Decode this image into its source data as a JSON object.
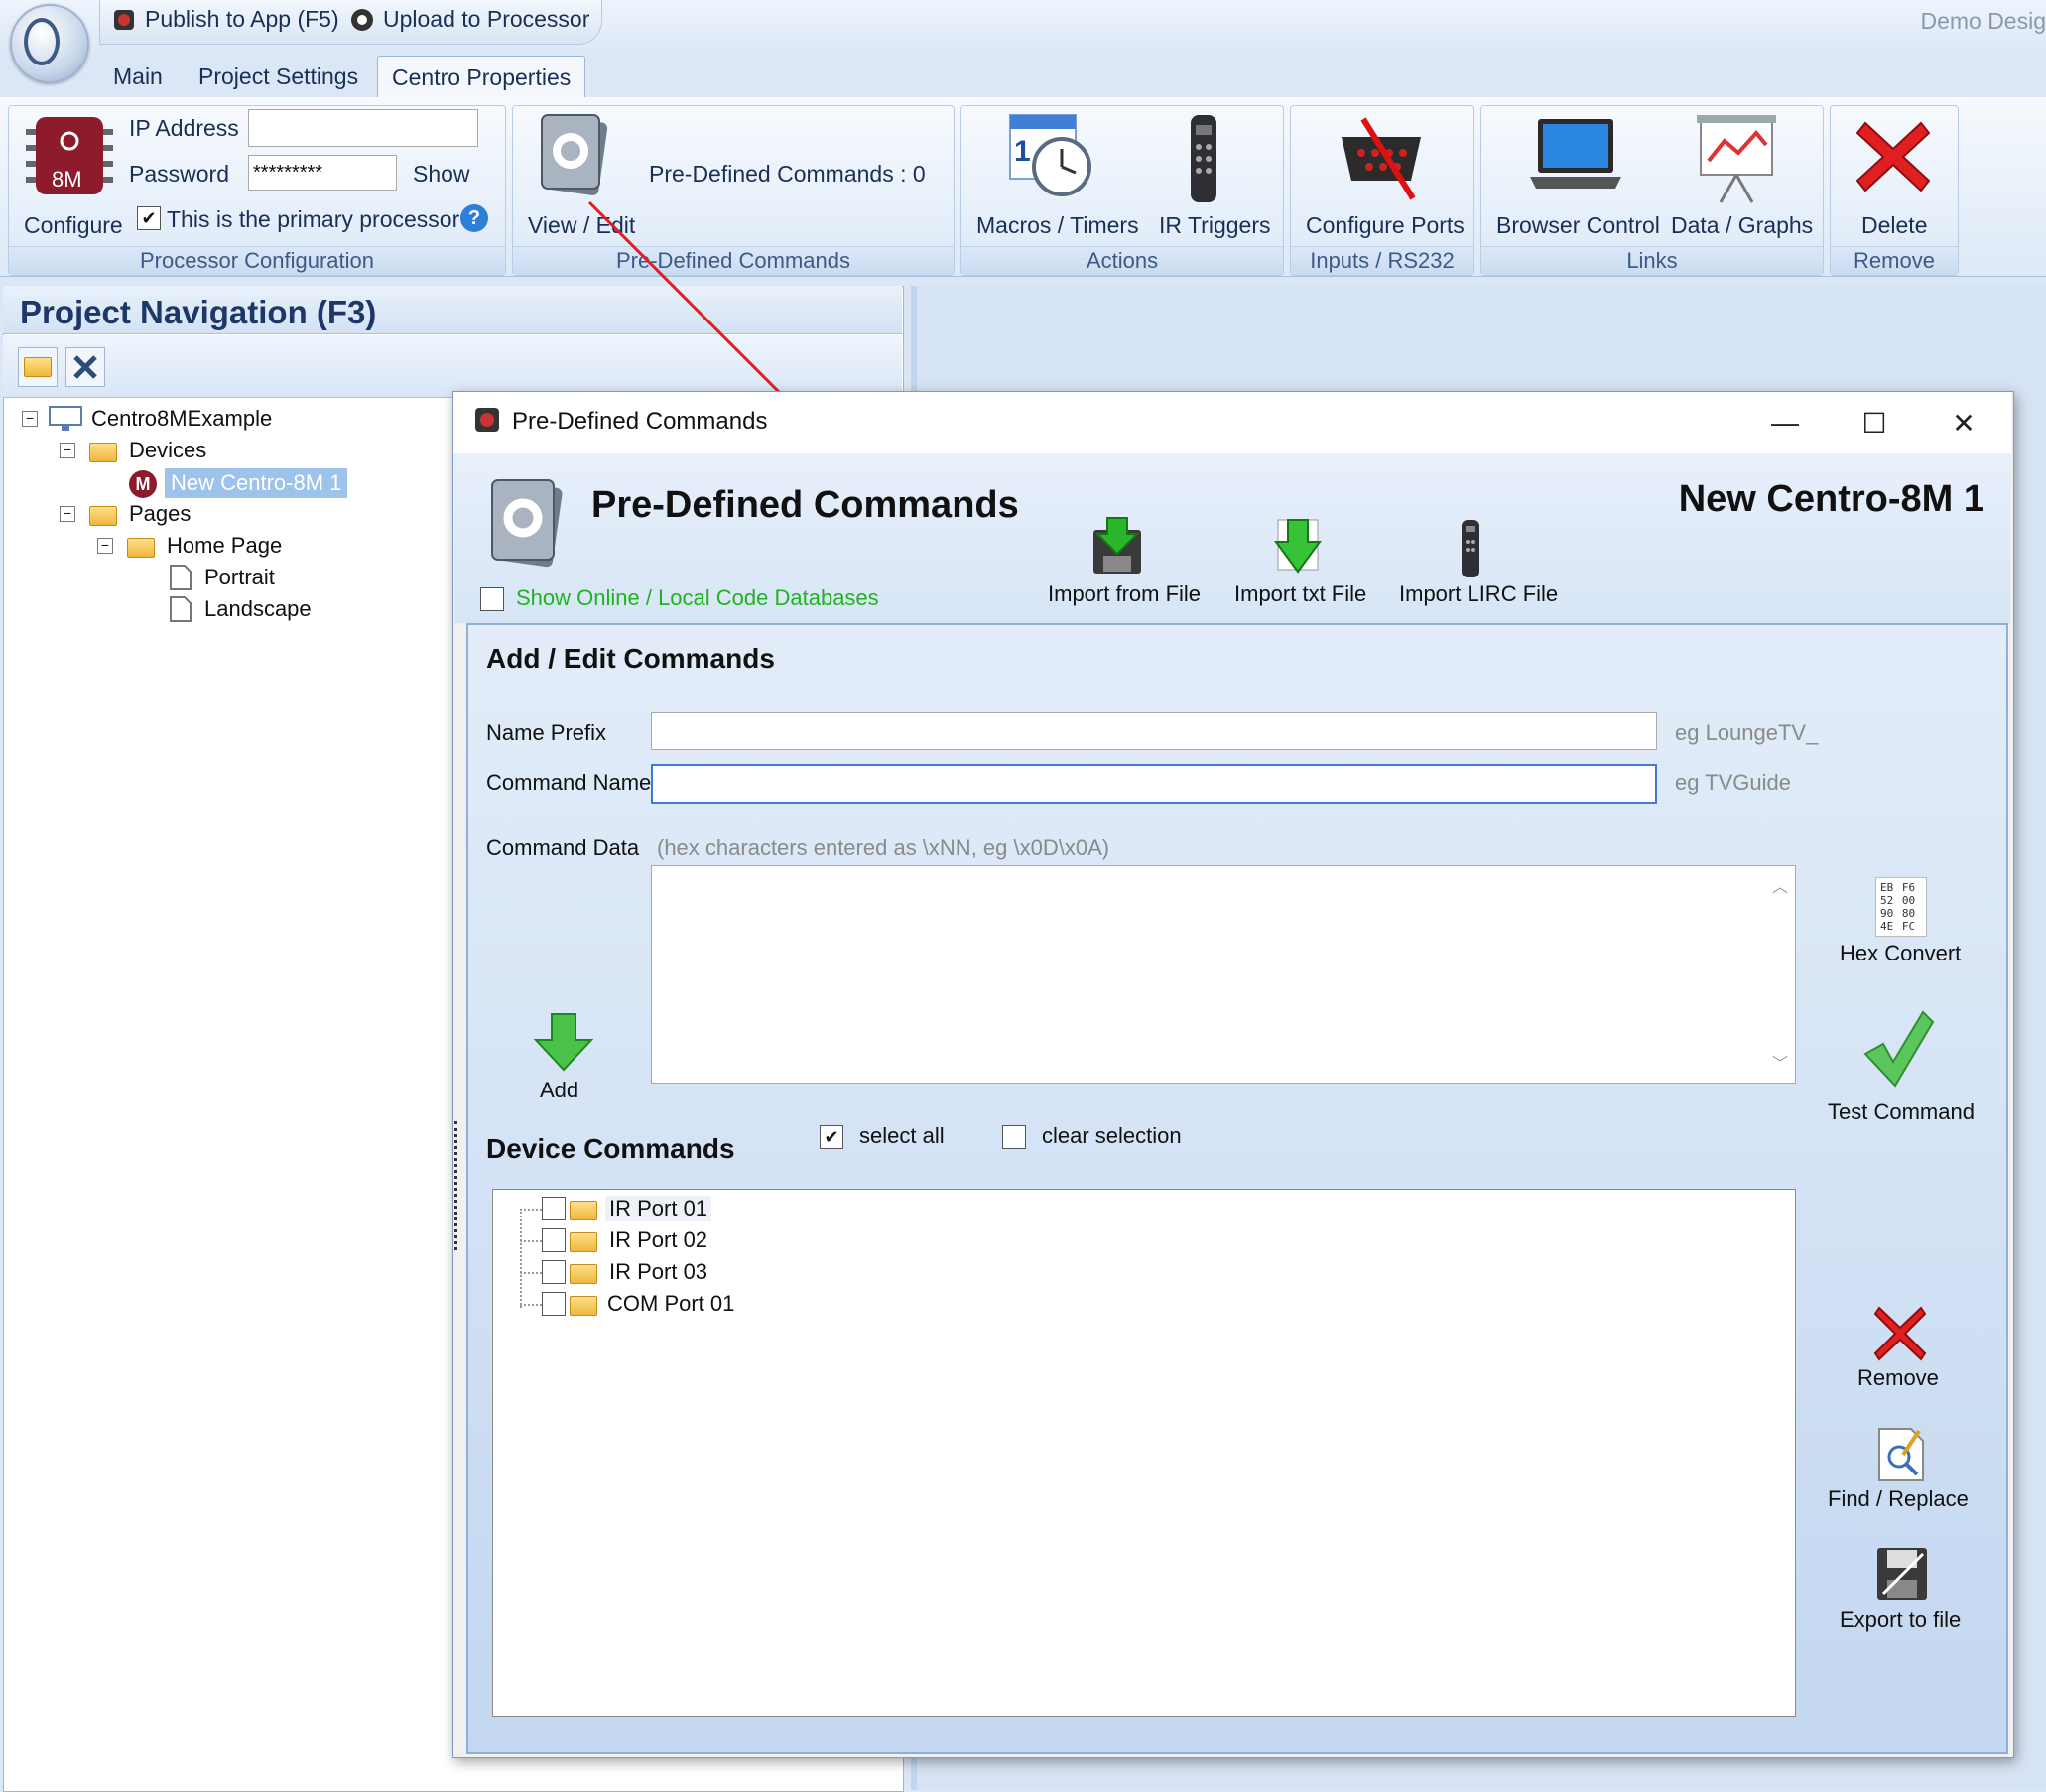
{
  "quickbar": {
    "publish_label": "Publish to App (F5)",
    "upload_label": "Upload to Processor",
    "app_title": "Demo Desig"
  },
  "tabs": [
    {
      "label": "Main"
    },
    {
      "label": "Project Settings"
    },
    {
      "label": "Centro Properties"
    }
  ],
  "ribbon": {
    "processor": {
      "configure_label": "Configure",
      "chip_text": "8M",
      "ip_label": "IP Address",
      "ip_value": "",
      "password_label": "Password",
      "password_value": "*********",
      "show_label": "Show",
      "primary_label": "This is the primary processor",
      "help_icon": "?",
      "caption": "Processor Configuration"
    },
    "predefined": {
      "view_edit_label": "View / Edit",
      "count_label": "Pre-Defined Commands : 0",
      "caption": "Pre-Defined Commands"
    },
    "actions": {
      "macros_label": "Macros / Timers",
      "ir_label": "IR Triggers",
      "calendar_number": "1",
      "caption": "Actions"
    },
    "inputs": {
      "configure_ports_label": "Configure Ports",
      "caption": "Inputs / RS232"
    },
    "links": {
      "browser_label": "Browser Control",
      "data_label": "Data / Graphs",
      "caption": "Links"
    },
    "remove": {
      "delete_label": "Delete",
      "caption": "Remove"
    }
  },
  "navigation": {
    "title": "Project Navigation (F3)",
    "tree": {
      "root": "Centro8MExample",
      "devices": "Devices",
      "device_item": "New Centro-8M 1",
      "device_badge": "M",
      "pages": "Pages",
      "home_page": "Home Page",
      "portrait": "Portrait",
      "landscape": "Landscape"
    }
  },
  "dialog": {
    "window_title": "Pre-Defined Commands",
    "heading": "Pre-Defined Commands",
    "device_name": "New Centro-8M 1",
    "show_online_label": "Show Online / Local Code Databases",
    "import_file_label": "Import from File",
    "import_txt_label": "Import txt File",
    "import_lirc_label": "Import LIRC File",
    "add_edit_title": "Add / Edit Commands",
    "name_prefix_label": "Name Prefix",
    "name_prefix_value": "",
    "name_prefix_hint": "eg LoungeTV_",
    "command_name_label": "Command Name",
    "command_name_value": "",
    "command_name_hint": "eg TVGuide",
    "command_data_label": "Command Data",
    "command_data_hint": "(hex characters entered as \\xNN, eg \\x0D\\x0A)",
    "command_data_value": "",
    "hex_icon_text": "EB F6 52 00 90 80 4E FC",
    "hex_convert_label": "Hex Convert",
    "test_command_label": "Test Command",
    "add_label": "Add",
    "device_commands_title": "Device Commands",
    "select_all_label": "select all",
    "clear_selection_label": "clear selection",
    "ports": [
      "IR Port 01",
      "IR Port 02",
      "IR Port 03",
      "COM Port 01"
    ],
    "remove_label": "Remove",
    "find_replace_label": "Find / Replace",
    "export_label": "Export to file"
  },
  "colors": {
    "accent_red": "#e02020",
    "ribbon_blue": "#3d5a86",
    "green_link": "#1fb41f"
  }
}
